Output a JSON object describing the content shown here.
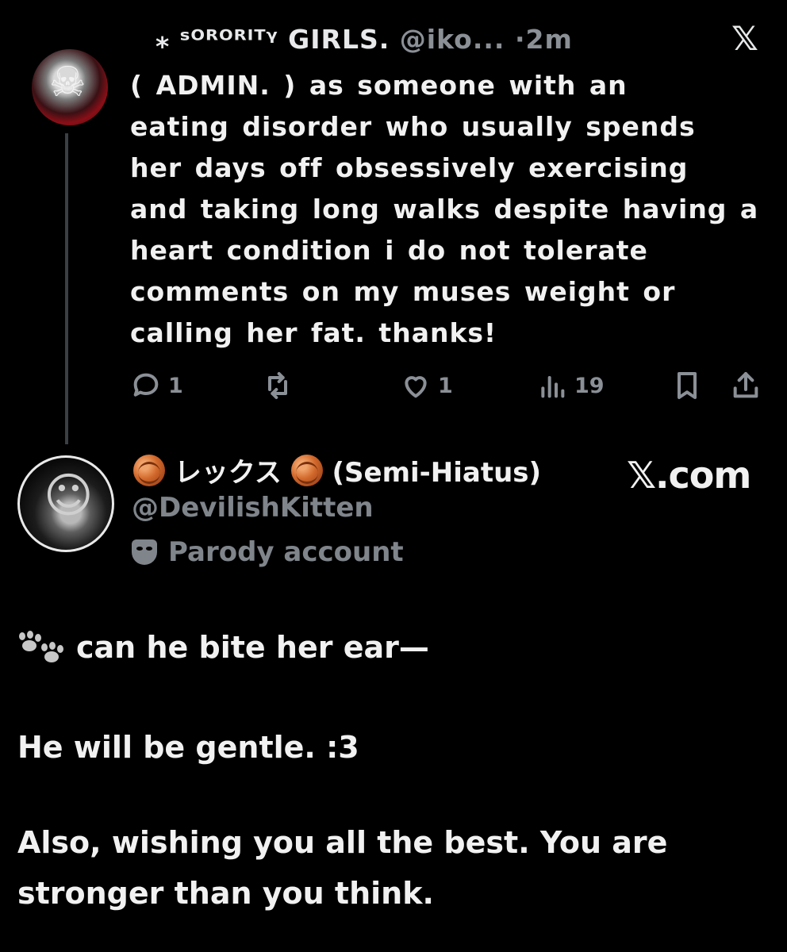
{
  "tweet1": {
    "display_name": "⁎ ˢᴼᴿᴼᴿᴵᵀᵞ GIRLS.",
    "handle": "@iko...",
    "time": "·2m",
    "body": "( ADMIN. ) as someone with an\neating disorder who usually spends\nher days off obsessively exercising\nand taking long walks despite having a\nheart condition i do not tolerate\ncomments on my muses weight or\ncalling her fat. thanks!",
    "actions": {
      "replies": "1",
      "likes": "1",
      "views": "19"
    },
    "icons": [
      "reply-icon",
      "repost-icon",
      "like-icon",
      "views-icon",
      "bookmark-icon",
      "share-icon",
      "x-logo-icon"
    ]
  },
  "tweet2": {
    "display_name_jp": "レックス",
    "display_name_suffix": "(Semi-Hiatus)",
    "handle": "@DevilishKitten",
    "badge": "Parody account",
    "watermark": "𝕏.com",
    "lines": [
      "can he bite her ear—",
      "He will be gentle. :3",
      "Also, wishing you all the best. You are",
      "stronger than you think."
    ],
    "icons": [
      "yarn-icon",
      "theater-mask-icon",
      "paw-prints-icon"
    ]
  },
  "colors": {
    "background": "#000000",
    "text": "#e7e9ea",
    "muted": "#8b9097"
  }
}
